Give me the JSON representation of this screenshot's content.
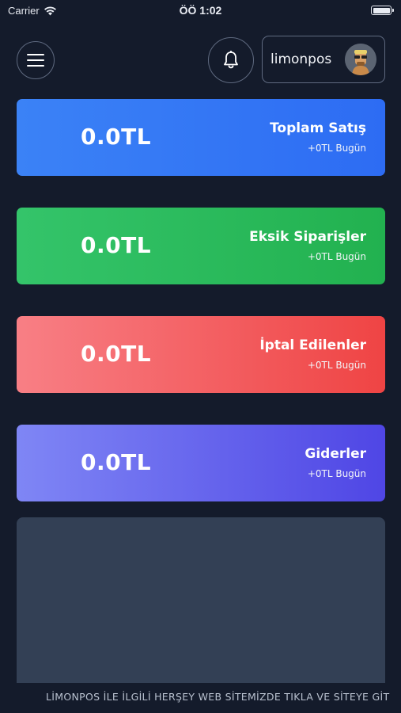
{
  "status_bar": {
    "carrier": "Carrier",
    "time": "ÖÖ 1:02"
  },
  "header": {
    "username": "limonpos"
  },
  "cards": [
    {
      "amount": "0.0TL",
      "title": "Toplam Satış",
      "subtitle": "+0TL Bugün",
      "color": "#3b82f6"
    },
    {
      "amount": "0.0TL",
      "title": "Eksik Siparişler",
      "subtitle": "+0TL Bugün",
      "color": "#22b14f"
    },
    {
      "amount": "0.0TL",
      "title": "İptal Edilenler",
      "subtitle": "+0TL Bugün",
      "color": "#ef4444"
    },
    {
      "amount": "0.0TL",
      "title": "Giderler",
      "subtitle": "+0TL Bugün",
      "color": "#4f46e5"
    }
  ],
  "footer": {
    "marquee": "LİMONPOS İLE İLGİLİ HERŞEY WEB SİTEMİZDE TIKLA VE SİTEYE GİT"
  }
}
